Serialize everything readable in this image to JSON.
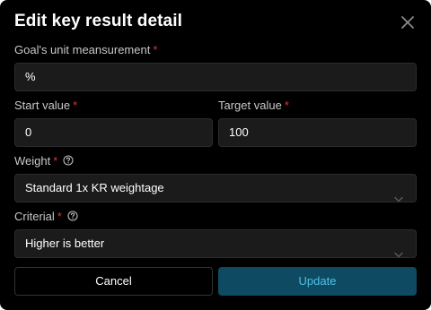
{
  "dialog": {
    "title": "Edit key result detail",
    "close_icon": "close-icon"
  },
  "form": {
    "unit": {
      "label": "Goal's unit meansurement",
      "required_mark": "*",
      "value": "%"
    },
    "start": {
      "label": "Start value",
      "required_mark": "*",
      "value": "0"
    },
    "target": {
      "label": "Target value",
      "required_mark": "*",
      "value": "100"
    },
    "weight": {
      "label": "Weight",
      "required_mark": "*",
      "help_icon": "help-circle-icon",
      "selected": "Standard 1x KR weightage",
      "chevron_icon": "chevron-down-icon"
    },
    "criterial": {
      "label": "Criterial",
      "required_mark": "*",
      "help_icon": "help-circle-icon",
      "selected": "Higher is better",
      "chevron_icon": "chevron-down-icon"
    }
  },
  "actions": {
    "cancel_label": "Cancel",
    "update_label": "Update"
  },
  "colors": {
    "background": "#000000",
    "field_bg": "#1b1b1b",
    "required": "#e5303a",
    "primary_bg": "#0e4b62",
    "primary_text": "#4fc0e8"
  }
}
